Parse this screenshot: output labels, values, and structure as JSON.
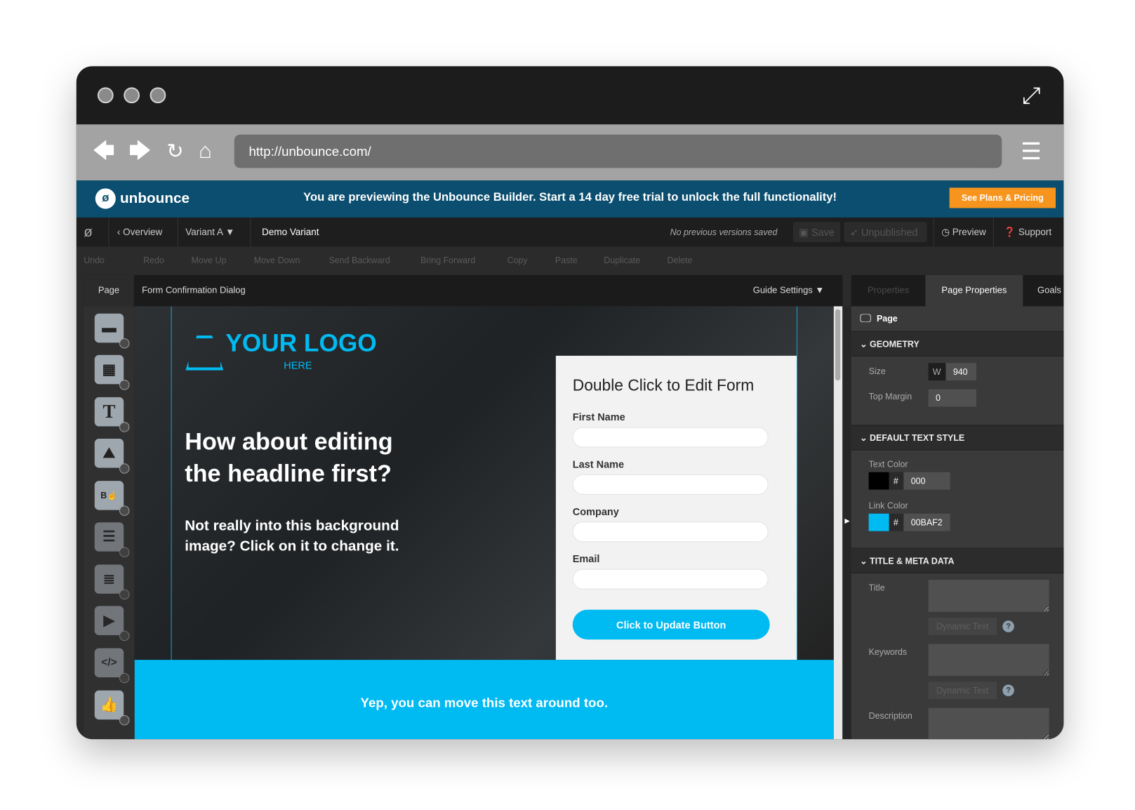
{
  "browser": {
    "url": "http://unbounce.com/"
  },
  "banner": {
    "logo": "unbounce",
    "message": "You are previewing the Unbounce Builder. Start a 14 day free trial to unlock the full functionality!",
    "cta": "See Plans & Pricing"
  },
  "topnav": {
    "overview": "‹ Overview",
    "variant": "Variant A ▼",
    "variant_name": "Demo Variant",
    "versions": "No previous versions saved",
    "save": "Save",
    "unpublished": "Unpublished",
    "preview": "Preview",
    "support": "Support ▼"
  },
  "toolbar": {
    "items": [
      "Undo",
      "Redo",
      "Move Up",
      "Move Down",
      "Send Backward",
      "Bring Forward",
      "Copy",
      "Paste",
      "Duplicate",
      "Delete"
    ]
  },
  "canvas_header": {
    "page_tab": "Page",
    "dialog_tab": "Form Confirmation Dialog",
    "guide": "Guide Settings ▼"
  },
  "right_tabs": {
    "properties": "Properties",
    "page_properties": "Page Properties",
    "goals": "Goals"
  },
  "canvas": {
    "logo_main": "YOUR LOGO",
    "logo_sub": "HERE",
    "headline": "How about editing the headline first?",
    "subtext": "Not really into this background image? Click on it to change it.",
    "cyan_text": "Yep, you can move this text around too."
  },
  "form": {
    "title": "Double Click to Edit Form",
    "fields": [
      "First Name",
      "Last Name",
      "Company",
      "Email"
    ],
    "button": "Click to Update Button"
  },
  "panel": {
    "page": "Page",
    "geometry": "GEOMETRY",
    "size_label": "Size",
    "w_label": "W",
    "width": "940",
    "top_margin_label": "Top Margin",
    "top_margin": "0",
    "text_style": "DEFAULT TEXT STYLE",
    "text_color_label": "Text Color",
    "text_color": "000",
    "link_color_label": "Link Color",
    "link_color": "00BAF2",
    "hash": "#",
    "meta": "TITLE & META DATA",
    "title_label": "Title",
    "keywords_label": "Keywords",
    "description_label": "Description",
    "dynamic": "Dynamic Text",
    "help": "?"
  },
  "colors": {
    "accent": "#00baf2",
    "banner": "#0b4e6f",
    "cta": "#f7941d"
  }
}
